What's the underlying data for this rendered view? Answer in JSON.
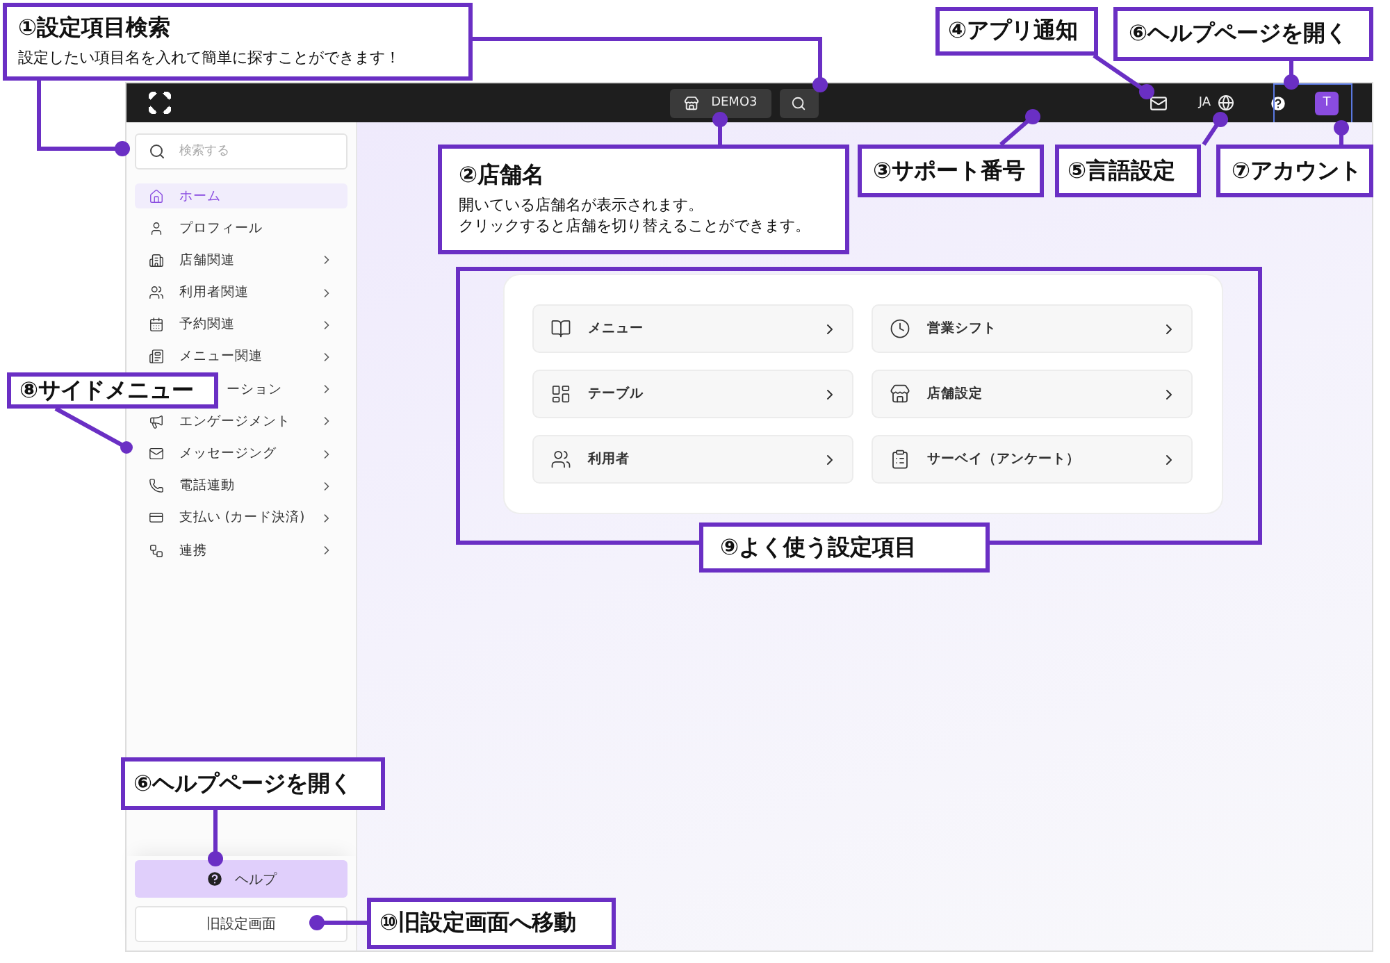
{
  "topbar": {
    "store_name": "DEMO3",
    "language": "JA",
    "avatar_initial": "T"
  },
  "sidebar": {
    "search": {
      "placeholder": "検索する"
    },
    "items": [
      {
        "label": "ホーム",
        "selected": true,
        "has_children": false,
        "covered": false
      },
      {
        "label": "プロフィール",
        "selected": false,
        "has_children": false,
        "covered": false
      },
      {
        "label": "店舗関連",
        "selected": false,
        "has_children": true,
        "covered": false
      },
      {
        "label": "利用者関連",
        "selected": false,
        "has_children": true,
        "covered": false
      },
      {
        "label": "予約関連",
        "selected": false,
        "has_children": true,
        "covered": false
      },
      {
        "label": "メニュー関連",
        "selected": false,
        "has_children": true,
        "covered": false
      },
      {
        "label": "ーション",
        "selected": false,
        "has_children": true,
        "covered": true
      },
      {
        "label": "エンゲージメント",
        "selected": false,
        "has_children": true,
        "covered": false
      },
      {
        "label": "メッセージング",
        "selected": false,
        "has_children": true,
        "covered": false
      },
      {
        "label": "電話連動",
        "selected": false,
        "has_children": true,
        "covered": false
      },
      {
        "label": "支払い (カード決済)",
        "selected": false,
        "has_children": true,
        "covered": false
      },
      {
        "label": "連携",
        "selected": false,
        "has_children": true,
        "covered": false
      }
    ],
    "help_button": "ヘルプ",
    "legacy_button": "旧設定画面"
  },
  "shortcuts": [
    {
      "label": "メニュー"
    },
    {
      "label": "営業シフト"
    },
    {
      "label": "テーブル"
    },
    {
      "label": "店舗設定"
    },
    {
      "label": "利用者"
    },
    {
      "label": "サーベイ（アンケート）"
    }
  ],
  "callouts": [
    {
      "title": "①設定項目検索",
      "description": [
        "設定したい項目名を入れて簡単に探すことができます！"
      ],
      "kind": "box"
    },
    {
      "title": "④アプリ通知",
      "kind": "box"
    },
    {
      "title": "⑥ヘルプページを開く",
      "kind": "box"
    },
    {
      "title": "②店舗名",
      "description": [
        "開いている店舗名が表示されます。",
        "クリックすると店舗を切り替えることができます。"
      ],
      "kind": "box"
    },
    {
      "title": "③サポート番号",
      "kind": "box"
    },
    {
      "title": "⑤言語設定",
      "kind": "box"
    },
    {
      "title": "⑦アカウント",
      "kind": "box"
    },
    {
      "title": "⑧サイドメニュー",
      "kind": "box"
    },
    {
      "title": "⑨よく使う設定項目",
      "kind": "frame"
    },
    {
      "title": "⑥ヘルプページを開く",
      "kind": "box"
    },
    {
      "title": "⑩旧設定画面へ移動",
      "kind": "box"
    }
  ]
}
